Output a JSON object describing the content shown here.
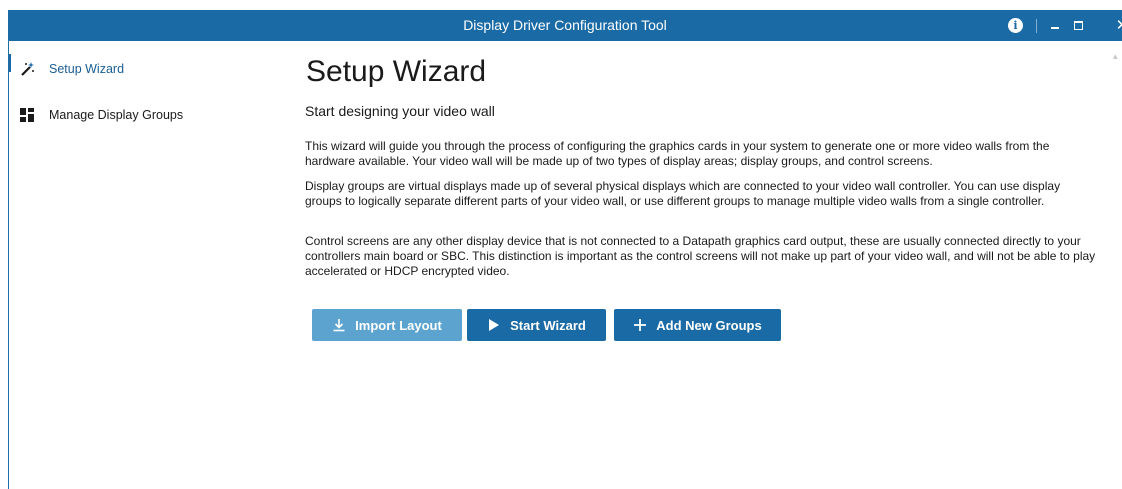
{
  "window": {
    "title": "Display Driver Configuration Tool",
    "info_icon": "i",
    "close_icon": "✕"
  },
  "sidebar": {
    "items": [
      {
        "label": "Setup Wizard",
        "icon": "magic-wand-icon",
        "active": true
      },
      {
        "label": "Manage Display Groups",
        "icon": "grid-icon",
        "active": false
      }
    ]
  },
  "main": {
    "title": "Setup Wizard",
    "subtitle": "Start designing your video wall",
    "paragraphs": [
      "This wizard will guide you through the process of configuring the graphics cards in your system to generate one or more video walls from the hardware available. Your video wall will be made up of two types of display areas; display groups, and control screens.",
      "Display groups are virtual displays made up of several physical displays which are connected to your video wall controller. You can use display groups to logically separate different parts of your video wall, or use different groups to manage multiple video walls from a single controller.",
      "Control screens are any other display device that is not connected to a Datapath graphics card output, these are usually connected directly to your controllers main board or SBC. This distinction is important as the control screens will not make up part of your video wall, and will not be able to play accelerated or HDCP encrypted video."
    ],
    "buttons": {
      "import_label": "Import Layout",
      "start_label": "Start Wizard",
      "add_label": "Add New Groups"
    }
  },
  "colors": {
    "titlebar": "#1a6aa6",
    "primary_button": "#1a6aa6",
    "secondary_button": "#5ca3d0"
  }
}
